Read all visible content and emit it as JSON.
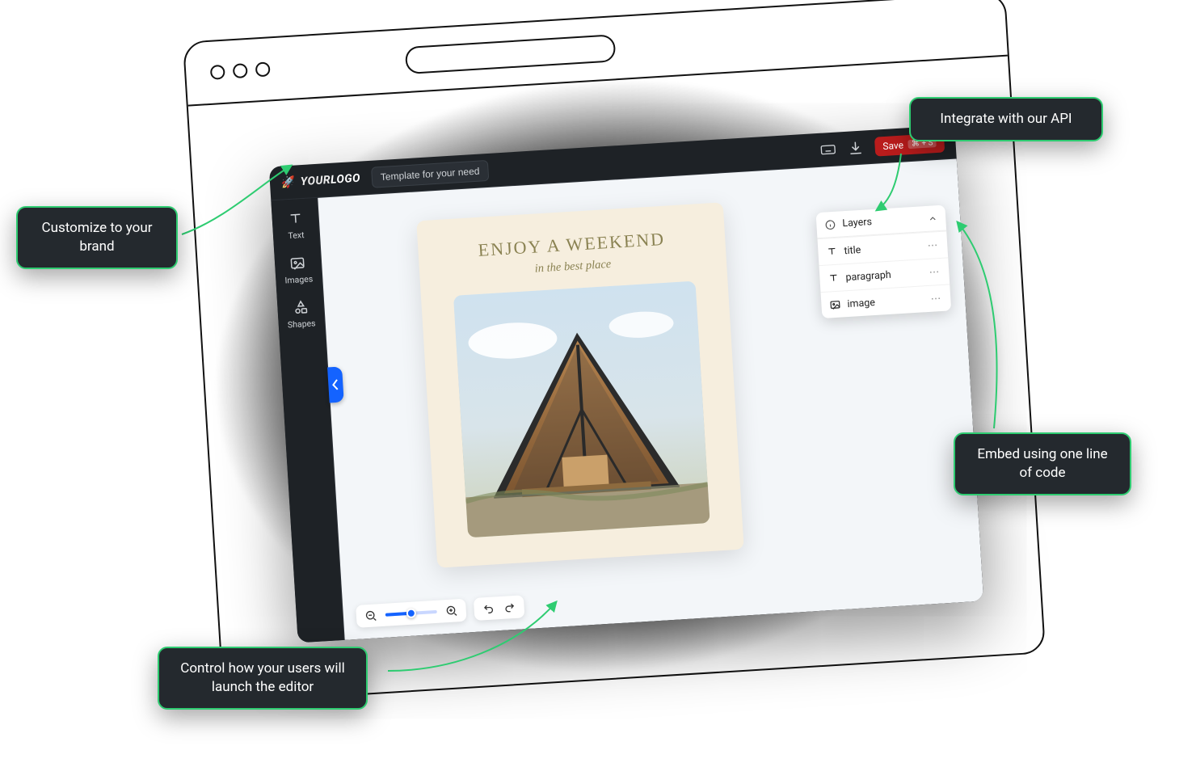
{
  "callouts": {
    "brand": "Customize to your brand",
    "api": "Integrate with our API",
    "embed": "Embed using one line of code",
    "launch": "Control how your users will launch the editor"
  },
  "editor": {
    "logo_prefix": "YOUR",
    "logo_suffix": "LOGO",
    "rocket": "🚀",
    "template_button": "Template for your need",
    "save_label": "Save",
    "save_shortcut": "⌘ + S",
    "sidebar": {
      "text": "Text",
      "images": "Images",
      "shapes": "Shapes"
    },
    "artboard": {
      "title": "ENJOY A WEEKEND",
      "subtitle": "in the best place"
    },
    "layers": {
      "title": "Layers",
      "items": [
        {
          "icon": "text",
          "label": "title"
        },
        {
          "icon": "text",
          "label": "paragraph"
        },
        {
          "icon": "image",
          "label": "image"
        }
      ]
    }
  }
}
